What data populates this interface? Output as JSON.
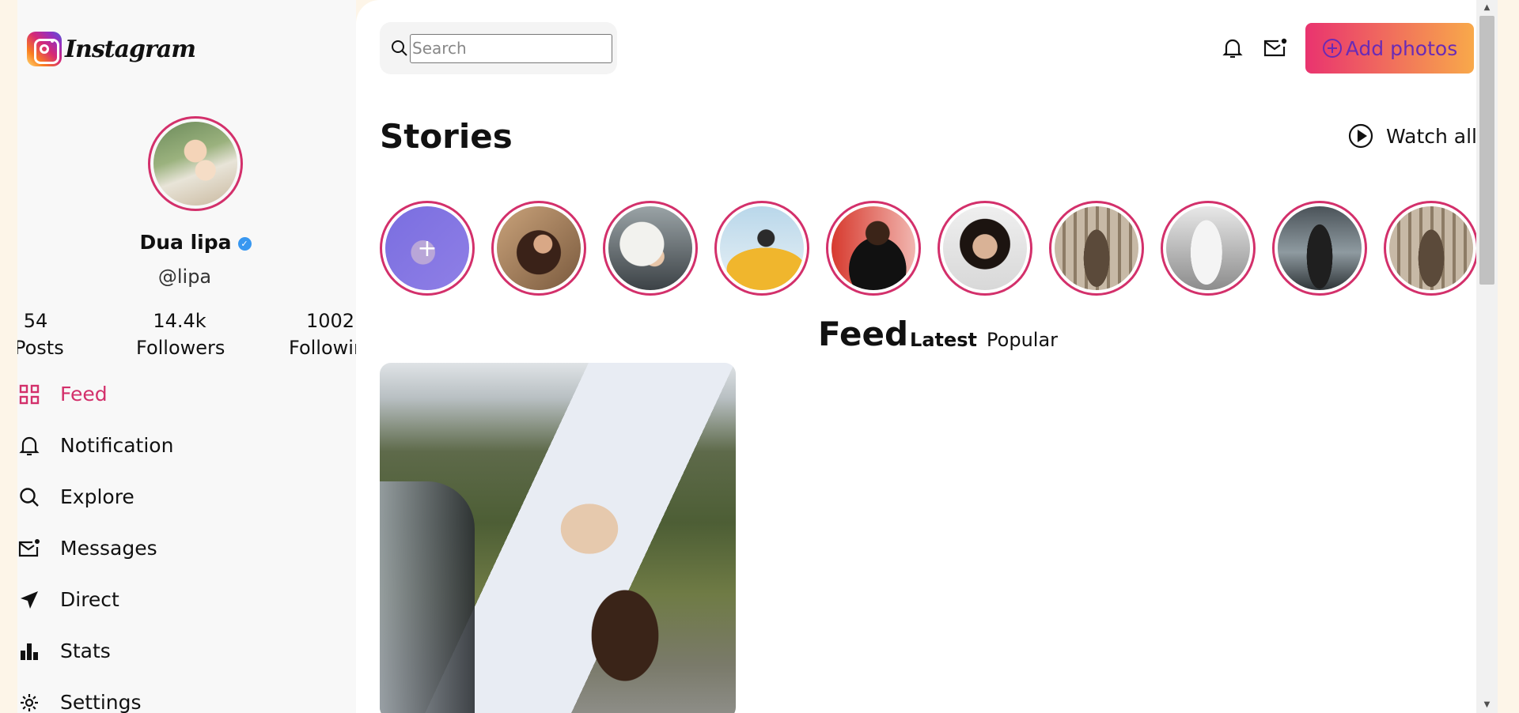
{
  "app": {
    "name": "Instagram"
  },
  "profile": {
    "name": "Dua lipa",
    "handle": "@lipa",
    "stats": [
      {
        "value": "54",
        "label": "Posts"
      },
      {
        "value": "14.4k",
        "label": "Followers"
      },
      {
        "value": "1002",
        "label": "Following"
      }
    ]
  },
  "nav": [
    {
      "label": "Feed",
      "icon": "grid-icon",
      "active": true
    },
    {
      "label": "Notification",
      "icon": "bell-icon"
    },
    {
      "label": "Explore",
      "icon": "search-icon"
    },
    {
      "label": "Messages",
      "icon": "mail-icon"
    },
    {
      "label": "Direct",
      "icon": "send-icon"
    },
    {
      "label": "Stats",
      "icon": "bar-chart-icon"
    },
    {
      "label": "Settings",
      "icon": "gear-icon"
    }
  ],
  "header": {
    "search_placeholder": "Search",
    "add_photos_label": "Add photos"
  },
  "stories": {
    "title": "Stories",
    "watch_all_label": "Watch all",
    "count": 10
  },
  "feed": {
    "title": "Feed",
    "tabs": [
      "Latest",
      "Popular"
    ]
  },
  "colors": {
    "accent": "#d3306b",
    "verified": "#3897f0",
    "button_gradient_start": "#e9336f",
    "button_gradient_end": "#f8a94a"
  }
}
